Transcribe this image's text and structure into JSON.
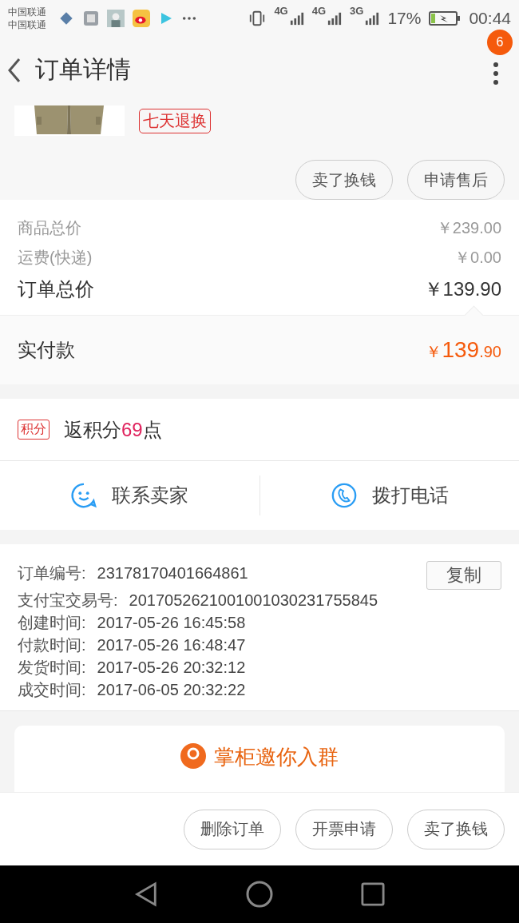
{
  "status_bar": {
    "carriers": [
      "中国联通",
      "中国联通"
    ],
    "network_labels": [
      "4G",
      "4G",
      "3G"
    ],
    "battery_percent": "17%",
    "time": "00:44"
  },
  "header": {
    "title": "订单详情",
    "badge": "6"
  },
  "product": {
    "image": {
      "kind": "picture"
    },
    "tag": "七天退换",
    "buttons": [
      "卖了换钱",
      "申请售后"
    ]
  },
  "price_rows": [
    {
      "label": "商品总价",
      "value": "￥239.00",
      "emphasis": false
    },
    {
      "label": "运费(快递)",
      "value": "￥0.00",
      "emphasis": false
    },
    {
      "label": "订单总价",
      "value": "￥139.90",
      "emphasis": true
    }
  ],
  "paid": {
    "label": "实付款",
    "currency": "￥",
    "integer": "139",
    "decimal": ".90"
  },
  "points": {
    "tag": "积分",
    "text_before": "返积分",
    "amount": "69",
    "text_after": "点"
  },
  "contact": [
    {
      "kind": "chat",
      "label": "联系卖家"
    },
    {
      "kind": "phone",
      "label": "拨打电话"
    }
  ],
  "order_info": {
    "copy_button": "复制",
    "rows": [
      {
        "label": "订单编号:",
        "value": "23178170401664861"
      },
      {
        "label": "支付宝交易号:",
        "value": "2017052621001001030231755845"
      },
      {
        "label": "创建时间:",
        "value": "2017-05-26 16:45:58"
      },
      {
        "label": "付款时间:",
        "value": "2017-05-26 16:48:47"
      },
      {
        "label": "发货时间:",
        "value": "2017-05-26 20:32:12"
      },
      {
        "label": "成交时间:",
        "value": "2017-06-05 20:32:22"
      }
    ]
  },
  "group_card": {
    "title": "掌柜邀你入群"
  },
  "bottom_buttons": [
    "删除订单",
    "开票申请",
    "卖了换钱"
  ]
}
